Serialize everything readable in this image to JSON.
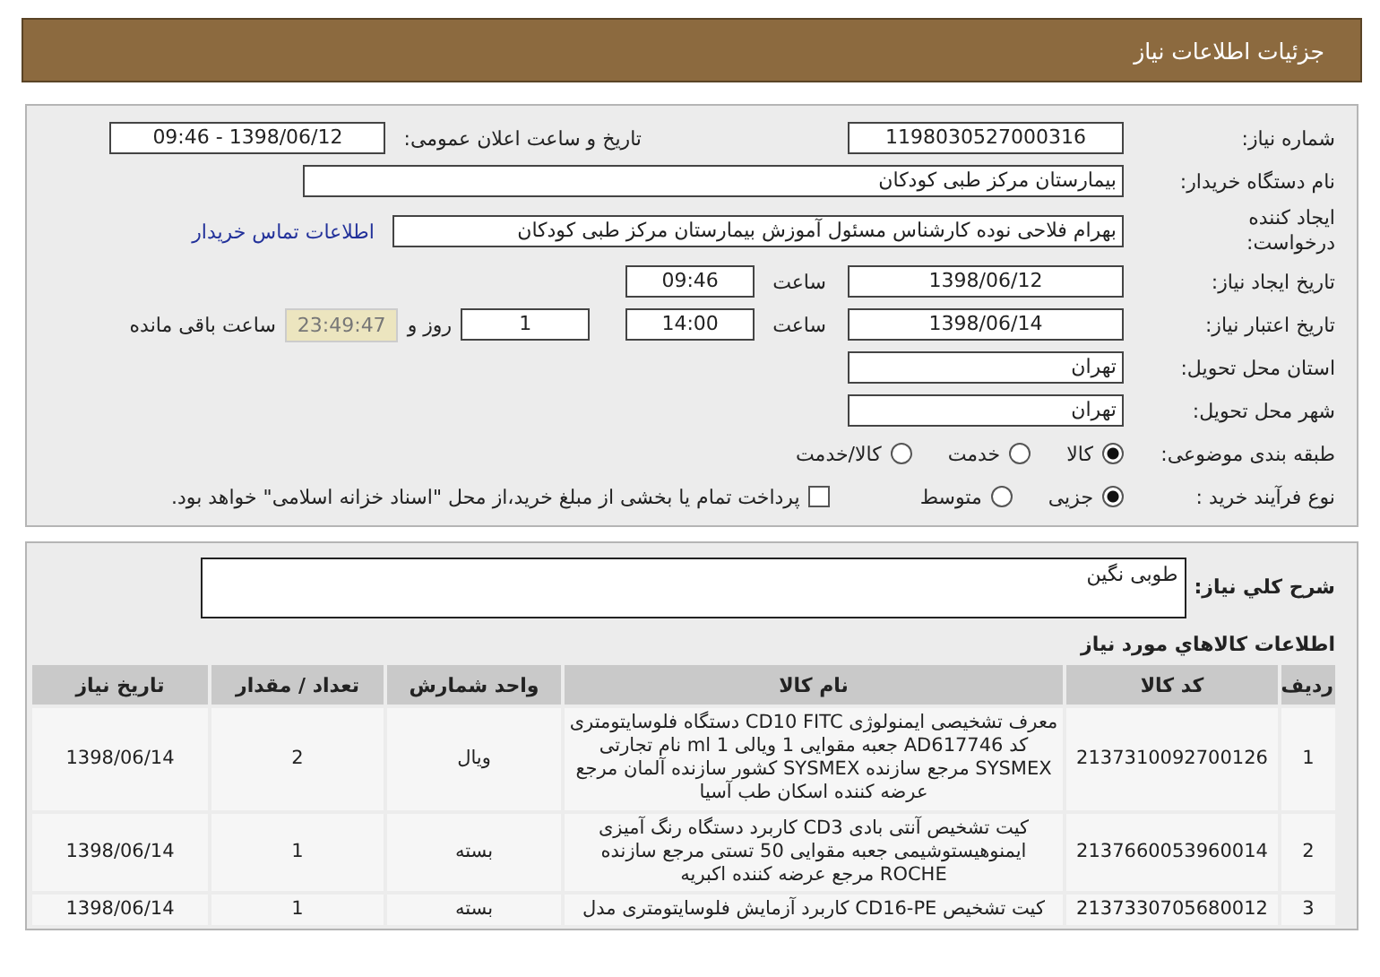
{
  "header": {
    "title": "جزئیات اطلاعات نیاز"
  },
  "details": {
    "need_number": {
      "label": "شماره نیاز:",
      "value": "1198030527000316"
    },
    "announce": {
      "label": "تاریخ و ساعت اعلان عمومی:",
      "value": "1398/06/12 - 09:46"
    },
    "buyer": {
      "label": "نام دستگاه خریدار:",
      "value": "بیمارستان مرکز طبی کودکان"
    },
    "creator": {
      "label": "ایجاد کننده درخواست:",
      "value": "بهرام فلاحی نوده کارشناس مسئول آموزش بیمارستان مرکز طبی کودکان",
      "link": "اطلاعات تماس خریدار"
    },
    "created": {
      "label": "تاریخ ایجاد نیاز:",
      "date": "1398/06/12",
      "time_label": "ساعت",
      "time": "09:46"
    },
    "valid": {
      "label": "تاریخ اعتبار نیاز:",
      "date": "1398/06/14",
      "time_label": "ساعت",
      "time": "14:00",
      "days": "1",
      "days_label": "روز و",
      "remaining": "23:49:47",
      "remaining_label": "ساعت باقی مانده"
    },
    "province": {
      "label": "استان محل تحویل:",
      "value": "تهران"
    },
    "city": {
      "label": "شهر محل تحویل:",
      "value": "تهران"
    },
    "category": {
      "label": "طبقه بندی موضوعی:",
      "options": [
        {
          "label": "کالا",
          "selected": true
        },
        {
          "label": "خدمت",
          "selected": false
        },
        {
          "label": "کالا/خدمت",
          "selected": false
        }
      ]
    },
    "process": {
      "label": "نوع فرآیند خرید :",
      "options": [
        {
          "label": "جزیی",
          "selected": true
        },
        {
          "label": "متوسط",
          "selected": false
        }
      ],
      "payment": {
        "text": "پرداخت تمام یا بخشی از مبلغ خرید،از محل \"اسناد خزانه اسلامی\" خواهد بود.",
        "checked": false
      }
    }
  },
  "description": {
    "label": "شرح کلي نیاز:",
    "value": "طوبی نگین"
  },
  "goods": {
    "title": "اطلاعات کالاهاي مورد نياز",
    "columns": [
      "ردیف",
      "کد کالا",
      "نام کالا",
      "واحد شمارش",
      "تعداد / مقدار",
      "تاریخ نیاز"
    ],
    "rows": [
      [
        "1",
        "2137310092700126",
        "معرف تشخیصی ایمنولوژی CD10 FITC دستگاه فلوسایتومتری کد AD617746 جعبه مقوایی 1 ویالی 1 ml نام تجارتی SYSMEX مرجع سازنده SYSMEX کشور سازنده آلمان مرجع عرضه کننده اسکان طب آسیا",
        "ویال",
        "2",
        "1398/06/14"
      ],
      [
        "2",
        "2137660053960014",
        "کیت تشخیص آنتی بادی CD3 کاربرد دستگاه رنگ آمیزی ایمنوهیستوشیمی جعبه مقوایی 50 تستی مرجع سازنده ROCHE مرجع عرضه کننده اکبریه",
        "بسته",
        "1",
        "1398/06/14"
      ],
      [
        "3",
        "2137330705680012",
        "کیت تشخیص CD16-PE کاربرد آزمایش فلوسایتومتری مدل",
        "بسته",
        "1",
        "1398/06/14"
      ]
    ]
  }
}
